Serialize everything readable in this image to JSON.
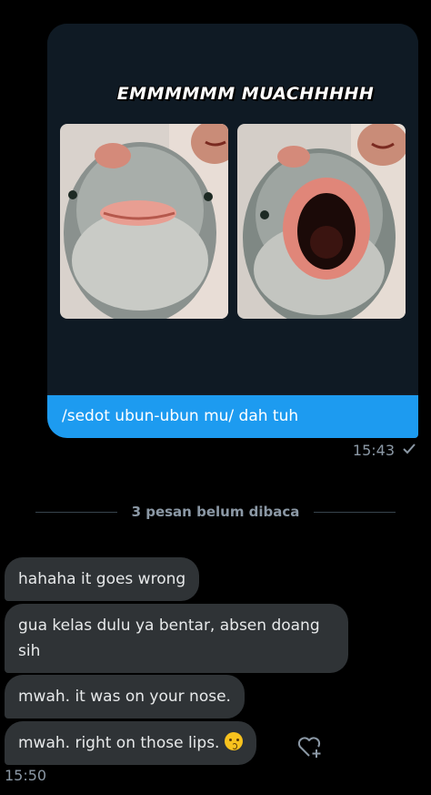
{
  "sent_message": {
    "image_caption": "EMMMMMM MUACHHHHH",
    "text": "/sedot ubun-ubun mu/ dah tuh",
    "time": "15:43",
    "status_icon": "check-icon"
  },
  "divider": {
    "label": "3 pesan belum dibaca"
  },
  "received_messages": [
    {
      "text": "hahaha it goes wrong"
    },
    {
      "text": "gua kelas dulu ya bentar, absen doang sih"
    },
    {
      "text": "mwah. it was on your nose."
    },
    {
      "text": "mwah. right on those lips.",
      "emoji": "kissing-face-emoji"
    }
  ],
  "received_time": "15:50",
  "react_icon": "heart-plus-icon",
  "colors": {
    "background": "#000000",
    "sent_bubble": "#1d9bf0",
    "received_bubble": "#2f3336",
    "media_card": "#15202b",
    "meta_text": "#8b98a5"
  }
}
